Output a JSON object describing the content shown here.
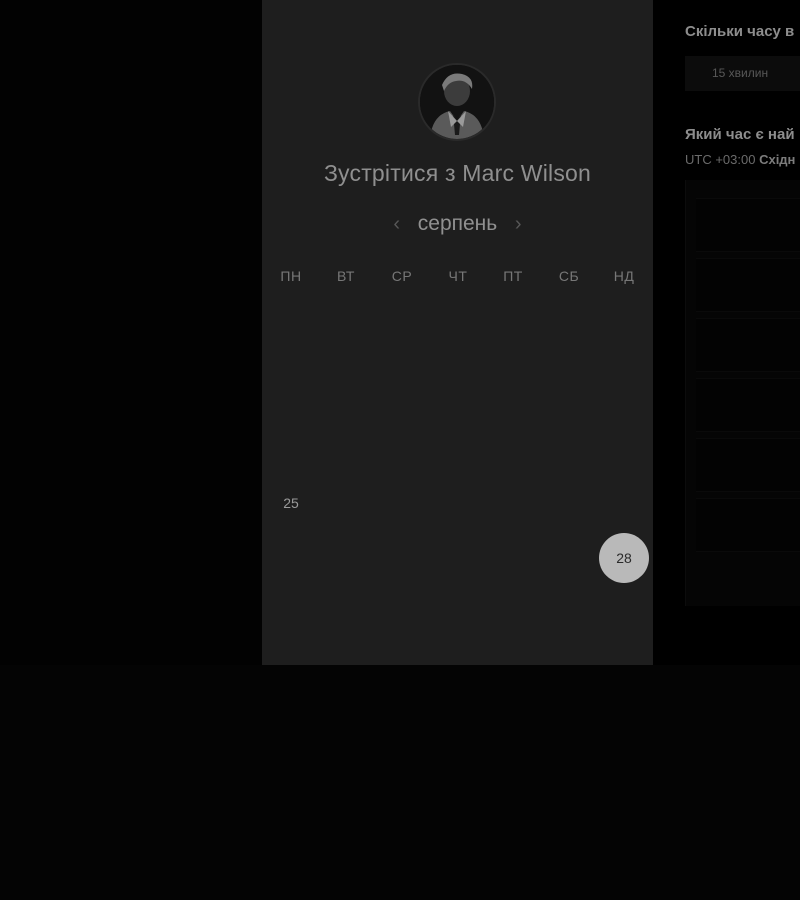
{
  "booking": {
    "title": "Зустрітися з Marc Wilson",
    "month": "серпень",
    "prev_month_icon": "‹",
    "next_month_icon": "›",
    "avatar_alt": "Marc Wilson"
  },
  "calendar": {
    "weekdays": [
      "ПН",
      "ВТ",
      "СР",
      "ЧТ",
      "ПТ",
      "СБ",
      "НД"
    ],
    "rows": [
      [
        "",
        "",
        "",
        "",
        "",
        "",
        ""
      ],
      [
        "",
        "",
        "",
        "",
        "",
        "",
        ""
      ],
      [
        "",
        "",
        "",
        "",
        "",
        "",
        ""
      ],
      [
        "25",
        "",
        "",
        "",
        "",
        "",
        ""
      ],
      [
        "",
        "",
        "",
        "",
        "",
        "",
        "28"
      ]
    ],
    "selected_day": "28",
    "available_days": [
      "25"
    ]
  },
  "side_panel": {
    "duration_question": "Скільки часу в",
    "duration_value": "15 хвилин",
    "time_question": "Який час є най",
    "timezone_prefix": "UTC +03:00",
    "timezone_name": "Східн"
  },
  "colors": {
    "background": "#000000",
    "card": "#1e1e1e",
    "selected_day": "#b9b9b9"
  }
}
